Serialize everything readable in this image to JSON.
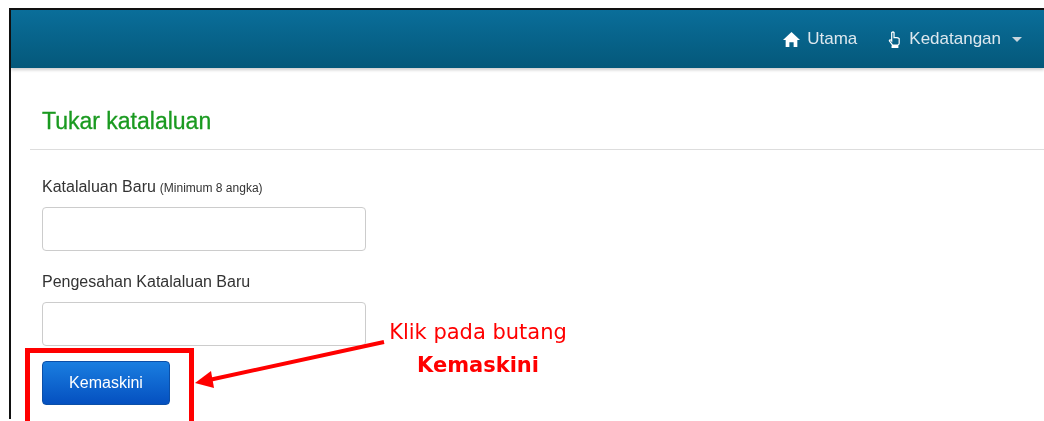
{
  "nav": {
    "items": [
      {
        "kind": "home",
        "label": "Utama",
        "dropdown": false
      },
      {
        "kind": "hand",
        "label": "Kedatangan",
        "dropdown": true
      }
    ]
  },
  "page": {
    "title": "Tukar katalaluan"
  },
  "form": {
    "fields": [
      {
        "label": "Katalaluan Baru",
        "hint": "(Minimum 8 angka)"
      },
      {
        "label": "Pengesahan Katalaluan Baru"
      }
    ],
    "submit": "Kemaskini"
  },
  "annotation": {
    "text": "Klik pada butang **Kemaskini**"
  }
}
